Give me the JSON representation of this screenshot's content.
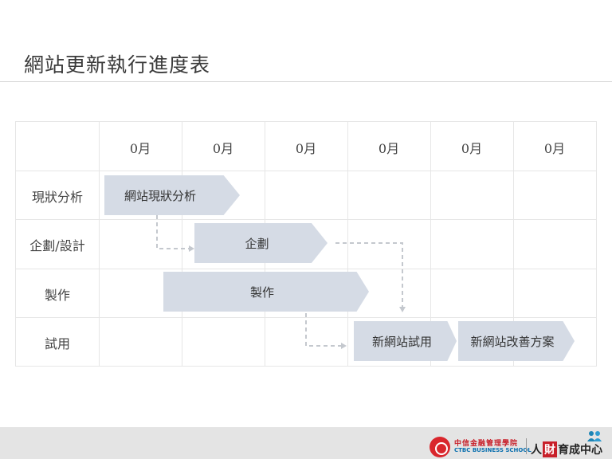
{
  "title": "網站更新執行進度表",
  "months": [
    "0月",
    "0月",
    "0月",
    "0月",
    "0月",
    "0月"
  ],
  "rows": [
    "現狀分析",
    "企劃/設計",
    "製作",
    "試用"
  ],
  "bars": {
    "analysis": "網站現狀分析",
    "planning": "企劃",
    "production": "製作",
    "trial": "新網站試用",
    "improve": "新網站改善方案"
  },
  "footer": {
    "school_cn": "中信金融管理學院",
    "school_en": "CTBC BUSINESS SCHOOL",
    "talent_1": "人",
    "talent_2": "財",
    "talent_3": "育成中心"
  },
  "colors": {
    "bar": "#d5dbe5",
    "arrow": "#c0c4cc",
    "brand_red": "#c8202a",
    "brand_blue": "#0a6fae"
  }
}
